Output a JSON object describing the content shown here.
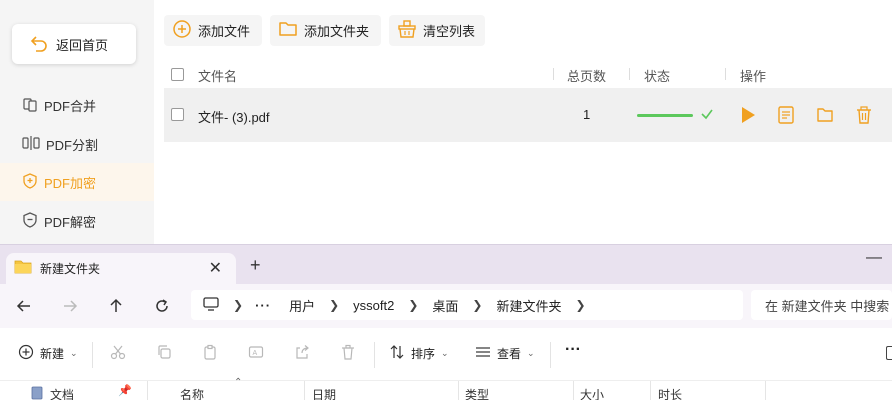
{
  "pdf_app": {
    "back_button": "返回首页",
    "sidebar": [
      {
        "label": "PDF合并",
        "icon": "merge-icon",
        "active": false
      },
      {
        "label": "PDF分割",
        "icon": "split-icon",
        "active": false
      },
      {
        "label": "PDF加密",
        "icon": "shield-lock-icon",
        "active": true
      },
      {
        "label": "PDF解密",
        "icon": "shield-unlock-icon",
        "active": false
      }
    ],
    "toolbar": {
      "add_file": "添加文件",
      "add_folder": "添加文件夹",
      "clear_list": "清空列表"
    },
    "table": {
      "headers": {
        "name": "文件名",
        "pages": "总页数",
        "status": "状态",
        "actions": "操作"
      },
      "rows": [
        {
          "name": "文件- (3).pdf",
          "pages": "1",
          "progress": 100
        }
      ]
    },
    "colors": {
      "accent": "#f0a020",
      "success": "#5cc85c"
    }
  },
  "explorer": {
    "tab_title": "新建文件夹",
    "breadcrumb": [
      "用户",
      "yssoft2",
      "桌面",
      "新建文件夹"
    ],
    "search_placeholder": "在 新建文件夹 中搜索",
    "commands": {
      "new": "新建",
      "sort": "排序",
      "view": "查看",
      "more": "···"
    },
    "nav_pane_item": "文档",
    "columns": [
      "名称",
      "日期",
      "类型",
      "大小",
      "时长"
    ]
  }
}
